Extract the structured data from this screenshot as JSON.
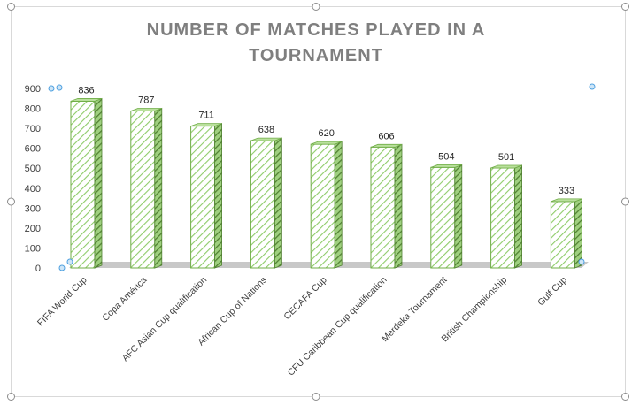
{
  "chart_data": {
    "type": "bar",
    "title": "NUMBER OF MATCHES PLAYED IN A TOURNAMENT",
    "title_lines": [
      "NUMBER OF MATCHES PLAYED IN A",
      "TOURNAMENT"
    ],
    "categories": [
      "FIFA World Cup",
      "Copa América",
      "AFC Asian Cup qualification",
      "African Cup of Nations",
      "CECAFA Cup",
      "CFU Caribbean Cup qualification",
      "Merdeka Tournament",
      "British Championship",
      "Gulf Cup"
    ],
    "values": [
      836,
      787,
      711,
      638,
      620,
      606,
      504,
      501,
      333
    ],
    "ylim": [
      0,
      900
    ],
    "yticks": [
      0,
      100,
      200,
      300,
      400,
      500,
      600,
      700,
      800,
      900
    ],
    "grid": false,
    "legend": "none",
    "data_labels": true,
    "style": "3d-column-hatched"
  },
  "colors": {
    "bar_fill": "#ffffff",
    "bar_hatch": "#8fcc6a",
    "bar_edge": "#70ad47",
    "bar_side": "#4f7f30",
    "floor": "#c8c8c8",
    "title": "#7f7f7f",
    "text": "#404040",
    "frame": "#d9d9d9",
    "handle": "#8c8c8c",
    "point_handle": "#4ea0e0"
  }
}
